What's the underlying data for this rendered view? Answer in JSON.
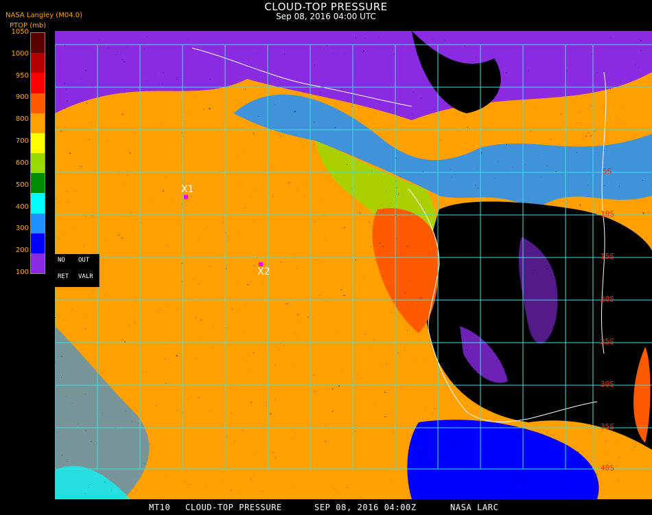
{
  "header": {
    "title": "CLOUD-TOP PRESSURE",
    "datetime": "Sep 08, 2016 04:00 UTC",
    "product": "NASA Langley (M04.0)",
    "units": "PTOP (mb)"
  },
  "legend": {
    "ticks": [
      "1050",
      "1000",
      "950",
      "900",
      "800",
      "700",
      "600",
      "500",
      "400",
      "300",
      "200",
      "100"
    ],
    "colors": [
      "#5a0000",
      "#b40000",
      "#ff0000",
      "#ff5a00",
      "#ffa000",
      "#ffff00",
      "#96dc00",
      "#008c00",
      "#00ffff",
      "#1e90ff",
      "#0000ff",
      "#8a2be2"
    ]
  },
  "map": {
    "latitudes": [
      "5S",
      "10S",
      "15S",
      "20S",
      "25S",
      "30S",
      "35S",
      "40S"
    ],
    "infobox": {
      "no": "NO",
      "out": "OUT",
      "ret": "RET",
      "valr": "VALR"
    },
    "markers": [
      {
        "label": "X1"
      },
      {
        "label": "X2"
      }
    ]
  },
  "footer": {
    "id": "MT10",
    "name": "CLOUD-TOP PRESSURE",
    "date": "SEP 08, 2016 04:00Z",
    "source": "NASA LARC"
  }
}
